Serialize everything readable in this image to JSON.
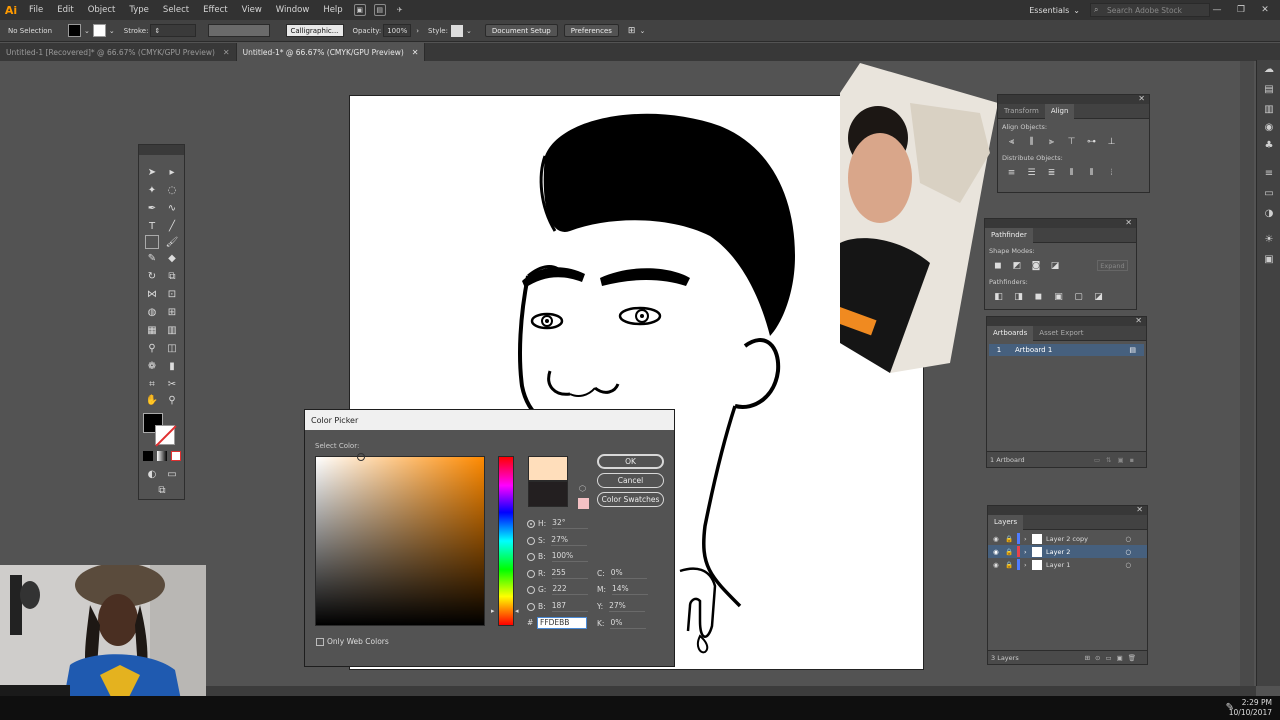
{
  "menubar": {
    "logo": "Ai",
    "items": [
      "File",
      "Edit",
      "Object",
      "Type",
      "Select",
      "Effect",
      "View",
      "Window",
      "Help"
    ],
    "workspace": "Essentials",
    "search_placeholder": "Search Adobe Stock"
  },
  "controlbar": {
    "selection": "No Selection",
    "stroke_label": "Stroke:",
    "brush": "Calligraphic...",
    "opacity_label": "Opacity:",
    "opacity_value": "100%",
    "style_label": "Style:",
    "document_setup": "Document Setup",
    "preferences": "Preferences"
  },
  "tabs": [
    {
      "label": "Untitled-1 [Recovered]* @ 66.67% (CMYK/GPU Preview)",
      "active": false
    },
    {
      "label": "Untitled-1* @ 66.67% (CMYK/GPU Preview)",
      "active": true
    }
  ],
  "align_panel": {
    "tabs": [
      "Transform",
      "Align"
    ],
    "align_objects": "Align Objects:",
    "distribute_objects": "Distribute Objects:"
  },
  "pathfinder_panel": {
    "title": "Pathfinder",
    "shape_modes": "Shape Modes:",
    "expand": "Expand",
    "pathfinders": "Pathfinders:"
  },
  "artboards_panel": {
    "tabs": [
      "Artboards",
      "Asset Export"
    ],
    "rows": [
      {
        "num": "1",
        "name": "Artboard 1"
      }
    ],
    "footer": "1 Artboard"
  },
  "layers_panel": {
    "title": "Layers",
    "layers": [
      {
        "name": "Layer 2 copy",
        "color": "#4f7cff"
      },
      {
        "name": "Layer 2",
        "color": "#e8434c"
      },
      {
        "name": "Layer 1",
        "color": "#4f7cff"
      }
    ],
    "footer": "3 Layers"
  },
  "color_picker": {
    "title": "Color Picker",
    "select_color": "Select Color:",
    "ok": "OK",
    "cancel": "Cancel",
    "swatches": "Color Swatches",
    "only_web": "Only Web Colors",
    "fields": {
      "H": "32°",
      "S": "27%",
      "B": "100%",
      "R": "255",
      "G": "222",
      "Bb": "187",
      "C": "0%",
      "M": "14%",
      "Y": "27%",
      "K": "0%"
    },
    "hex": "FFDEBB",
    "new_color": "#ffdebb",
    "old_color": "#231f20"
  },
  "taskbar": {
    "time": "2:29 PM",
    "date": "10/10/2017"
  },
  "colors": {
    "accent": "#ff9a00",
    "ui_bg": "#535353"
  }
}
